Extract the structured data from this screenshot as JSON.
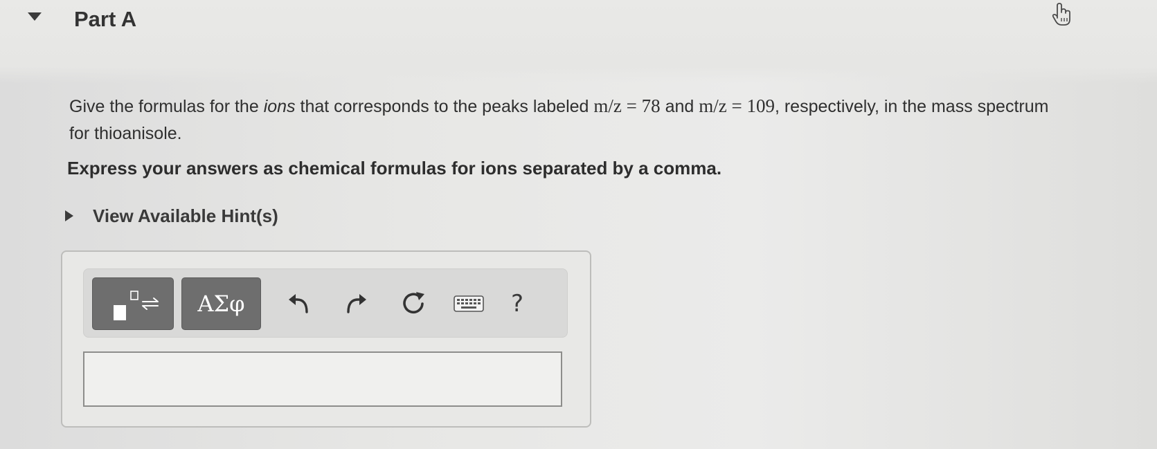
{
  "part": {
    "title": "Part A"
  },
  "question": {
    "p1": "Give the formulas for the ",
    "ions_italic": "ions",
    "p2": " that corresponds to the peaks labeled ",
    "m1": "m/z = 78",
    "p3": " and ",
    "m2": "m/z = 109",
    "p4": ", respectively, in the mass spectrum for thioanisole."
  },
  "instruction": "Express your answers as chemical formulas for ions separated by a comma.",
  "hints": {
    "label": "View Available Hint(s)"
  },
  "toolbar": {
    "greek_label": "ΑΣφ",
    "help_label": "?"
  },
  "answer": {
    "value": ""
  },
  "icons": {
    "collapse": "triangle-down-icon",
    "hand": "hand-pointer-icon",
    "hints": "triangle-right-icon",
    "template": "template-arrows-icon",
    "undo": "undo-arrow-icon",
    "redo": "redo-arrow-icon",
    "reset": "refresh-icon",
    "keyboard": "keyboard-icon"
  },
  "colors": {
    "toolbar_button": "#6e6e6e",
    "text": "#2e2e2e",
    "panel_border": "#bdbdbb"
  }
}
